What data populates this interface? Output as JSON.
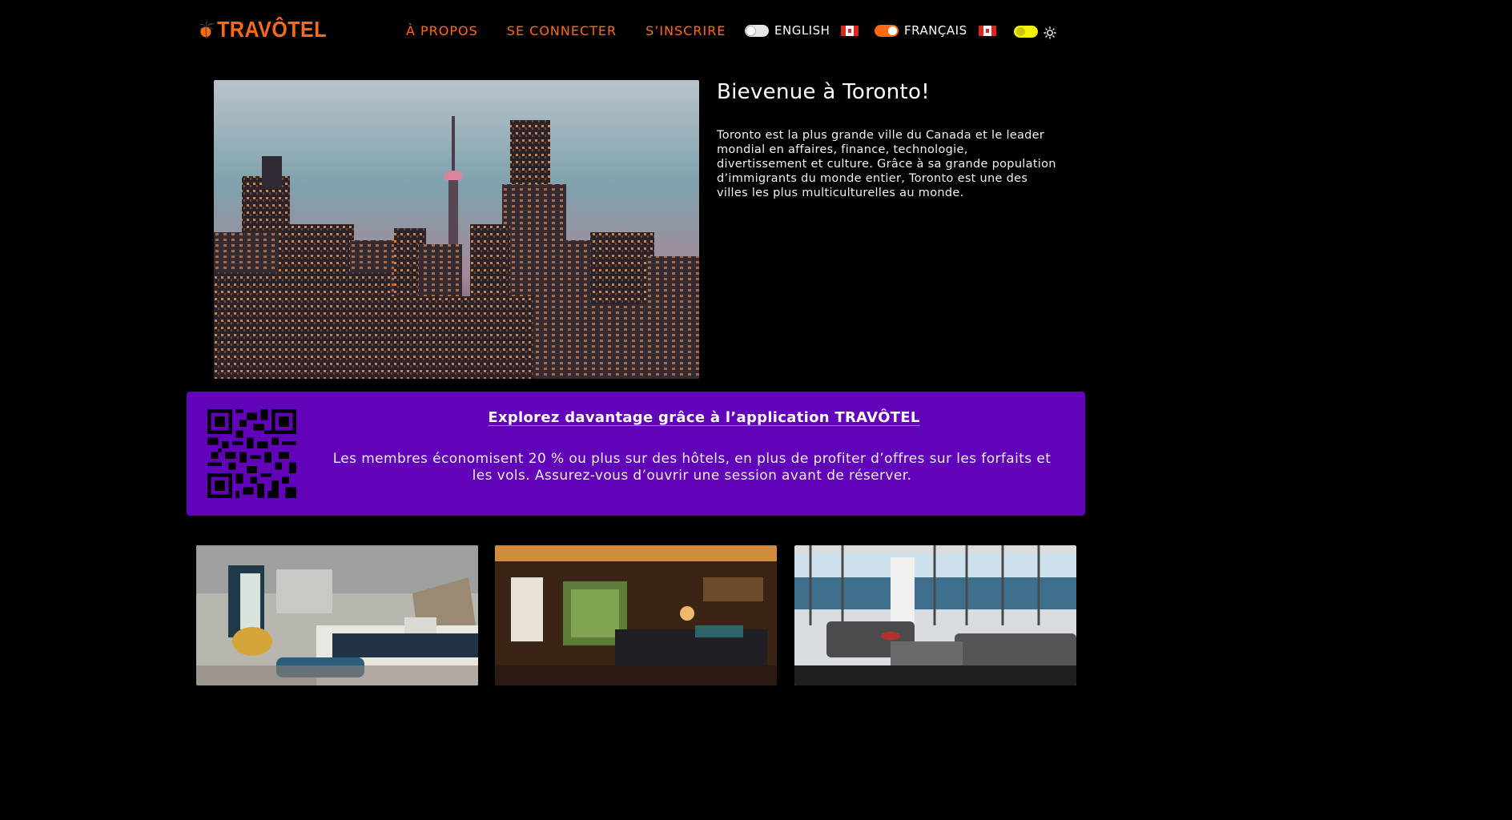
{
  "header": {
    "brand": "TRAVÔTEL",
    "nav": [
      "À PROPOS",
      "SE CONNECTER",
      "S’INSCRIRE"
    ],
    "languages": [
      {
        "label": "ENGLISH",
        "active": false
      },
      {
        "label": "FRANÇAIS",
        "active": true
      }
    ],
    "theme_toggle_icon": "sun-icon"
  },
  "hero": {
    "title": "Bievenue à Toronto!",
    "text": "Toronto est la plus grande ville du Canada et le leader mondial en affaires, finance, technologie, divertissement et culture. Grâce à sa grande population d’immigrants du monde entier, Toronto est une des villes les plus multiculturelles au monde."
  },
  "promo": {
    "title": "Explorez davantage grâce à l’application TRAVÔTEL",
    "text": "Les membres économisent 20 % ou plus sur des hôtels, en plus de profiter d’offres sur les forfaits et les vols. Assurez-vous d’ouvrir une session avant de réserver."
  },
  "colors": {
    "accent": "#ff6a13",
    "promo_bg": "#6104b9",
    "theme_toggle": "#f2f20a",
    "background": "#000000"
  }
}
